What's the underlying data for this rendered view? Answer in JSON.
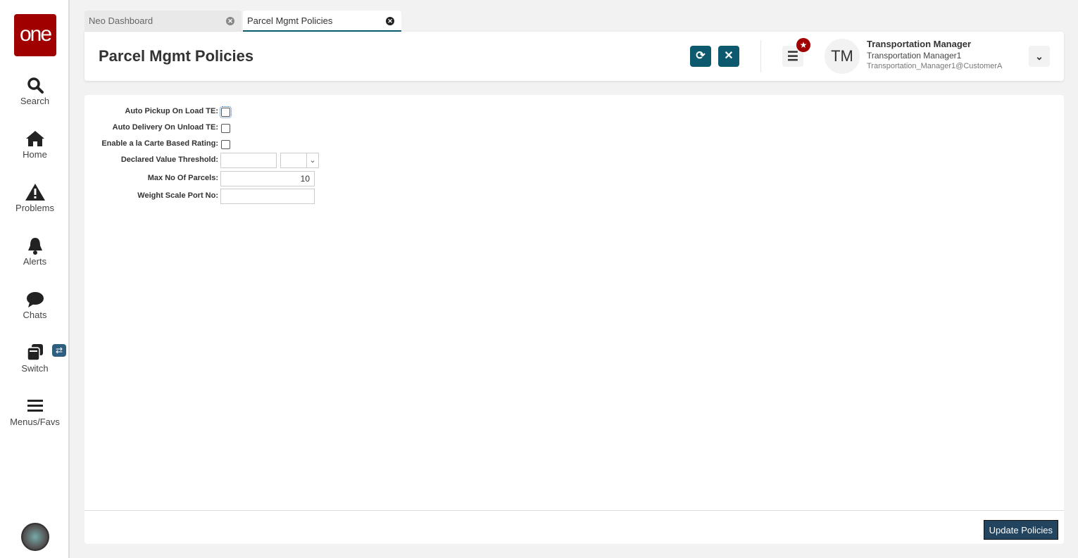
{
  "logo": "one",
  "sidebar": {
    "items": [
      {
        "label": "Search"
      },
      {
        "label": "Home"
      },
      {
        "label": "Problems"
      },
      {
        "label": "Alerts"
      },
      {
        "label": "Chats"
      },
      {
        "label": "Switch"
      },
      {
        "label": "Menus/Favs"
      }
    ]
  },
  "tabs": [
    {
      "label": "Neo Dashboard",
      "active": false
    },
    {
      "label": "Parcel Mgmt Policies",
      "active": true
    }
  ],
  "header": {
    "title": "Parcel Mgmt Policies",
    "user_initials": "TM",
    "user_name": "Transportation Manager",
    "user_role": "Transportation Manager1",
    "user_email": "Transportation_Manager1@CustomerA"
  },
  "form": {
    "auto_pickup_label": "Auto Pickup On Load TE:",
    "auto_pickup": false,
    "auto_delivery_label": "Auto Delivery On Unload TE:",
    "auto_delivery": false,
    "a_la_carte_label": "Enable a la Carte Based Rating:",
    "a_la_carte": false,
    "declared_value_label": "Declared Value Threshold:",
    "declared_value": "",
    "declared_currency": "",
    "max_parcels_label": "Max No Of Parcels:",
    "max_parcels": "10",
    "weight_port_label": "Weight Scale Port No:",
    "weight_port": ""
  },
  "footer": {
    "update_label": "Update Policies"
  },
  "colors": {
    "brand": "#a00000",
    "accent": "#0d5a6e",
    "button": "#22445e"
  }
}
